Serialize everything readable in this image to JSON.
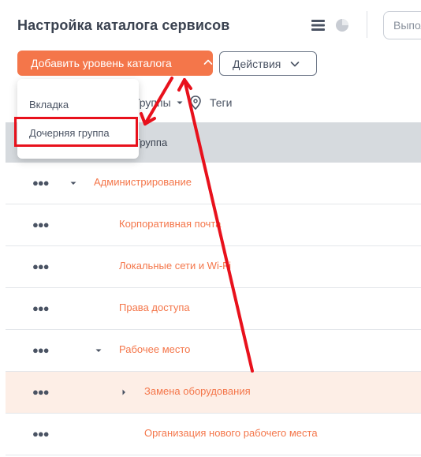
{
  "header": {
    "title": "Настройка каталога сервисов",
    "search_placeholder": "Выполнить поиск"
  },
  "toolbar": {
    "add_level_label": "Добавить уровень каталога",
    "actions_label": "Действия"
  },
  "filters": {
    "groups_label": "Группы",
    "tags_label": "Теги"
  },
  "table": {
    "column_label": "Группа"
  },
  "dropdown": {
    "items": [
      "Вкладка",
      "Дочерняя группа"
    ]
  },
  "rows": [
    {
      "label": "Администрирование",
      "level": 0,
      "expanded": true,
      "has_children": true
    },
    {
      "label": "Корпоративная почта",
      "level": 1,
      "has_children": false
    },
    {
      "label": "Локальные сети и Wi-Fi",
      "level": 1,
      "has_children": false
    },
    {
      "label": "Права доступа",
      "level": 1,
      "has_children": false
    },
    {
      "label": "Рабочее место",
      "level": 1,
      "expanded": true,
      "has_children": true
    },
    {
      "label": "Замена оборудования",
      "level": 2,
      "expanded": false,
      "has_children": true,
      "selected": true
    },
    {
      "label": "Организация нового рабочего места",
      "level": 2,
      "has_children": false
    }
  ],
  "colors": {
    "accent": "#f4764a",
    "annotation_red": "#e8111c",
    "header_bg": "#d6dade",
    "selected_row_bg": "#fdeee6"
  },
  "icons": {
    "menu": "hamburger-menu-icon",
    "chart": "pie-chart-icon",
    "tag": "tag-icon",
    "chevron": "chevron-icon",
    "more": "more-dots-icon",
    "caret": "caret-icon"
  }
}
